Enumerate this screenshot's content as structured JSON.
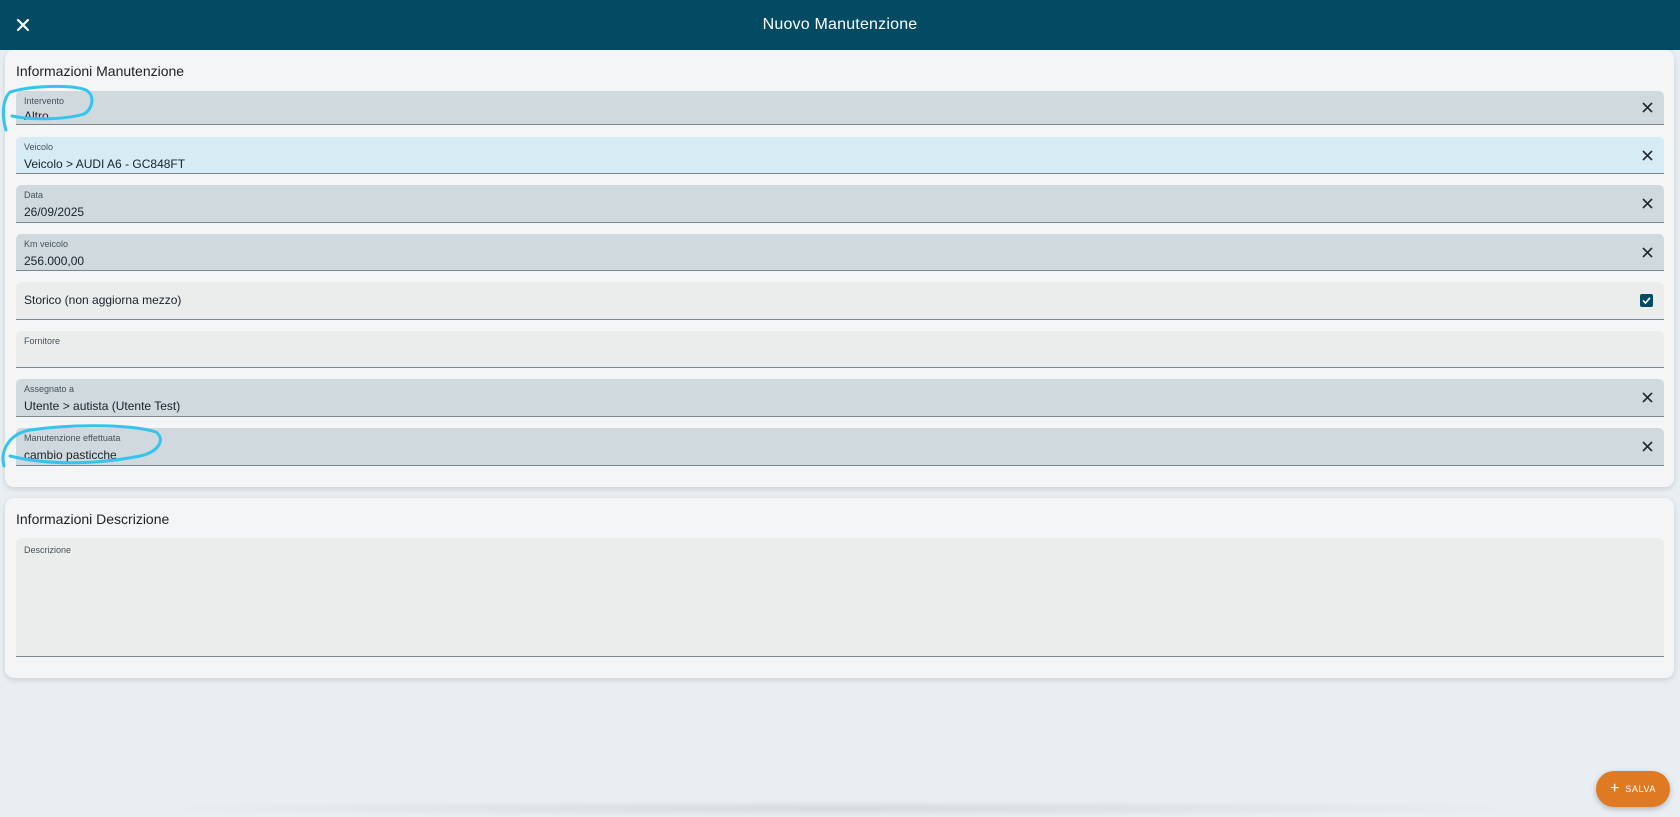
{
  "header": {
    "title": "Nuovo Manutenzione",
    "close_icon": "close-icon"
  },
  "section_info": {
    "title": "Informazioni Manutenzione",
    "fields": {
      "intervento": {
        "label": "Intervento",
        "value": "Altro"
      },
      "veicolo": {
        "label": "Veicolo",
        "value": "Veicolo > AUDI A6 - GC848FT"
      },
      "data": {
        "label": "Data",
        "value": "26/09/2025"
      },
      "km": {
        "label": "Km veicolo",
        "value": "256.000,00"
      },
      "storico": {
        "label": "Storico (non aggiorna mezzo)",
        "checked": true
      },
      "fornitore": {
        "label": "Fornitore",
        "value": ""
      },
      "assegnato": {
        "label": "Assegnato a",
        "value": "Utente > autista (Utente Test)"
      },
      "effettuata": {
        "label": "Manutenzione effettuata",
        "value": "cambio pasticche"
      }
    }
  },
  "section_desc": {
    "title": "Informazioni Descrizione",
    "descrizione": {
      "label": "Descrizione",
      "value": ""
    }
  },
  "fab": {
    "label": "SALVA",
    "icon": "plus-icon"
  },
  "colors": {
    "header_bg": "#034a63",
    "field_filled": "#cfd9de",
    "field_highlight": "#d6ebf3",
    "field_empty": "#ebedec",
    "fab_bg": "#e07a22",
    "annotation": "#35c4ee"
  }
}
